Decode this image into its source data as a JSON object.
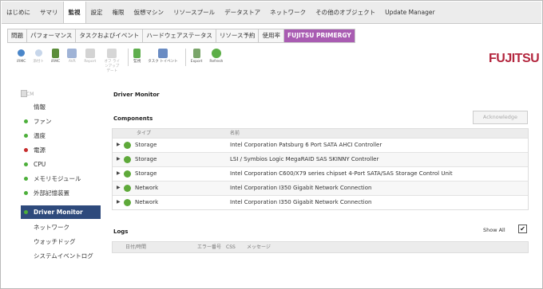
{
  "top_tabs": [
    "はじめに",
    "サマリ",
    "監視",
    "設定",
    "権限",
    "仮想マシン",
    "リソースプール",
    "データストア",
    "ネットワーク",
    "その他のオブジェクト",
    "Update Manager"
  ],
  "top_tab_active": "監視",
  "sub_tabs": [
    "問題",
    "パフォーマンス",
    "タスクおよびイベント",
    "ハードウェアステータス",
    "リソース予約",
    "使用率",
    "FUJITSU PRIMERGY"
  ],
  "toolbar": {
    "items": [
      {
        "label": "iRMC",
        "icon": "irmc-icon",
        "color": "#4a86c9"
      },
      {
        "label": "添付ト",
        "icon": "blink-icon",
        "color": "#9bbbe0"
      },
      {
        "label": "iRMC",
        "icon": "irmc-user-icon",
        "color": "#5b8d3a"
      },
      {
        "label": "AVR",
        "icon": "avr-icon",
        "color": "#5b7fb5"
      },
      {
        "label": "Report",
        "icon": "report-icon",
        "color": "#c2c2c2"
      },
      {
        "label": "オフ ラインアップ デート",
        "icon": "offline-update-icon",
        "color": "#c9c9c9"
      },
      {
        "label": "監視",
        "icon": "monitor-icon",
        "color": "#5fae4e"
      },
      {
        "label": "タスク トイベント",
        "icon": "task-icon",
        "color": "#6a8cc3"
      },
      {
        "label": "Export",
        "icon": "export-icon",
        "color": "#7aa56a"
      },
      {
        "label": "Refresh",
        "icon": "refresh-icon",
        "color": "#5cae47"
      }
    ]
  },
  "brand": "FUJITSU",
  "sidebar": {
    "cm": "CM",
    "items": [
      {
        "label": "情報",
        "dot": ""
      },
      {
        "label": "ファン",
        "dot": "#4caf3a"
      },
      {
        "label": "温度",
        "dot": "#4caf3a"
      },
      {
        "label": "電源",
        "dot": "#c62b2b"
      },
      {
        "label": "CPU",
        "dot": "#4caf3a"
      },
      {
        "label": "メモリモジュール",
        "dot": "#4caf3a"
      },
      {
        "label": "外部記憶装置",
        "dot": "#4caf3a"
      },
      {
        "label": "Driver Monitor",
        "dot": "#4caf3a"
      },
      {
        "label": "ネットワーク",
        "dot": ""
      },
      {
        "label": "ウォッチドッグ",
        "dot": ""
      },
      {
        "label": "システムイベントログ",
        "dot": ""
      }
    ],
    "selected_index": 7
  },
  "main": {
    "title": "Driver Monitor",
    "components_label": "Components",
    "acknowledge": "Acknowledge",
    "columns": [
      "タイプ",
      "名前"
    ],
    "rows": [
      {
        "type": "Storage",
        "name": "Intel Corporation Patsburg 6 Port SATA AHCI Controller"
      },
      {
        "type": "Storage",
        "name": "LSI / Symbios Logic MegaRAID SAS SKINNY Controller"
      },
      {
        "type": "Storage",
        "name": "Intel Corporation C600/X79 series chipset 4-Port SATA/SAS Storage Control Unit"
      },
      {
        "type": "Network",
        "name": "Intel Corporation I350 Gigabit Network Connection"
      },
      {
        "type": "Network",
        "name": "Intel Corporation I350 Gigabit Network Connection"
      }
    ],
    "logs_label": "Logs",
    "show_all": "Show All",
    "show_all_checked": "✔",
    "log_columns": [
      "日付/時間",
      "エラー番号",
      "CSS",
      "メッセージ"
    ]
  }
}
